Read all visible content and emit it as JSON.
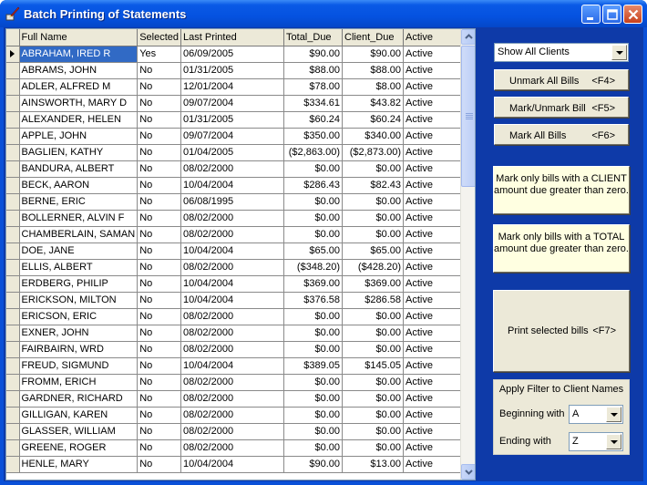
{
  "window": {
    "title": "Batch Printing of Statements",
    "accent_color": "#0a50d8",
    "selection_color": "#316ac5"
  },
  "grid": {
    "columns": [
      "Full Name",
      "Selected",
      "Last Printed",
      "Total_Due",
      "Client_Due",
      "Active"
    ],
    "rows": [
      [
        "ABRAHAM, IRED R",
        "Yes",
        "06/09/2005",
        "$90.00",
        "$90.00",
        "Active"
      ],
      [
        "ABRAMS, JOHN",
        "No",
        "01/31/2005",
        "$88.00",
        "$88.00",
        "Active"
      ],
      [
        "ADLER, ALFRED M",
        "No",
        "12/01/2004",
        "$78.00",
        "$8.00",
        "Active"
      ],
      [
        "AINSWORTH, MARY D",
        "No",
        "09/07/2004",
        "$334.61",
        "$43.82",
        "Active"
      ],
      [
        "ALEXANDER, HELEN",
        "No",
        "01/31/2005",
        "$60.24",
        "$60.24",
        "Active"
      ],
      [
        "APPLE, JOHN",
        "No",
        "09/07/2004",
        "$350.00",
        "$340.00",
        "Active"
      ],
      [
        "BAGLIEN, KATHY",
        "No",
        "01/04/2005",
        "($2,863.00)",
        "($2,873.00)",
        "Active"
      ],
      [
        "BANDURA, ALBERT",
        "No",
        "08/02/2000",
        "$0.00",
        "$0.00",
        "Active"
      ],
      [
        "BECK, AARON",
        "No",
        "10/04/2004",
        "$286.43",
        "$82.43",
        "Active"
      ],
      [
        "BERNE, ERIC",
        "No",
        "06/08/1995",
        "$0.00",
        "$0.00",
        "Active"
      ],
      [
        "BOLLERNER, ALVIN F",
        "No",
        "08/02/2000",
        "$0.00",
        "$0.00",
        "Active"
      ],
      [
        "CHAMBERLAIN, SAMAN",
        "No",
        "08/02/2000",
        "$0.00",
        "$0.00",
        "Active"
      ],
      [
        "DOE, JANE",
        "No",
        "10/04/2004",
        "$65.00",
        "$65.00",
        "Active"
      ],
      [
        "ELLIS, ALBERT",
        "No",
        "08/02/2000",
        "($348.20)",
        "($428.20)",
        "Active"
      ],
      [
        "ERDBERG, PHILIP",
        "No",
        "10/04/2004",
        "$369.00",
        "$369.00",
        "Active"
      ],
      [
        "ERICKSON, MILTON",
        "No",
        "10/04/2004",
        "$376.58",
        "$286.58",
        "Active"
      ],
      [
        "ERICSON, ERIC",
        "No",
        "08/02/2000",
        "$0.00",
        "$0.00",
        "Active"
      ],
      [
        "EXNER, JOHN",
        "No",
        "08/02/2000",
        "$0.00",
        "$0.00",
        "Active"
      ],
      [
        "FAIRBAIRN, WRD",
        "No",
        "08/02/2000",
        "$0.00",
        "$0.00",
        "Active"
      ],
      [
        "FREUD, SIGMUND",
        "No",
        "10/04/2004",
        "$389.05",
        "$145.05",
        "Active"
      ],
      [
        "FROMM, ERICH",
        "No",
        "08/02/2000",
        "$0.00",
        "$0.00",
        "Active"
      ],
      [
        "GARDNER, RICHARD",
        "No",
        "08/02/2000",
        "$0.00",
        "$0.00",
        "Active"
      ],
      [
        "GILLIGAN, KAREN",
        "No",
        "08/02/2000",
        "$0.00",
        "$0.00",
        "Active"
      ],
      [
        "GLASSER, WILLIAM",
        "No",
        "08/02/2000",
        "$0.00",
        "$0.00",
        "Active"
      ],
      [
        "GREENE, ROGER",
        "No",
        "08/02/2000",
        "$0.00",
        "$0.00",
        "Active"
      ],
      [
        "HENLE, MARY",
        "No",
        "10/04/2004",
        "$90.00",
        "$13.00",
        "Active"
      ]
    ]
  },
  "panel": {
    "show_filter_value": "Show All Clients",
    "unmark_all": {
      "label": "Unmark All Bills",
      "key": "<F4>"
    },
    "mark_unmark": {
      "label": "Mark/Unmark Bill",
      "key": "<F5>"
    },
    "mark_all": {
      "label": "Mark All Bills",
      "key": "<F6>"
    },
    "mark_client_positive": "Mark only bills with a CLIENT amount due greater than zero.",
    "mark_total_positive": "Mark only bills with a TOTAL amount due greater than zero.",
    "print_selected": {
      "label": "Print selected bills",
      "key": "<F7>"
    },
    "filter": {
      "title": "Apply Filter to Client Names",
      "beginning_label": "Beginning with",
      "beginning_value": "A",
      "ending_label": "Ending with",
      "ending_value": "Z"
    }
  }
}
